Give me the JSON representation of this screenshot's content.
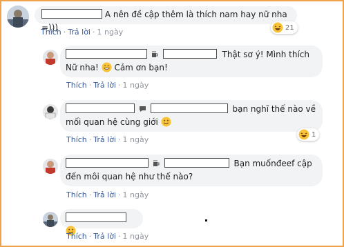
{
  "comments": [
    {
      "text": "A nên đề cập thêm là thích nam hay nữ nha =)))",
      "actions": {
        "like": "Thích",
        "reply": "Trả lời",
        "time": "1 ngày"
      },
      "reaction": {
        "emoji": "laughing",
        "count": "21"
      }
    },
    {
      "text_line1": "Thật sơ ý! Mình thích",
      "text_line2": "Nữ nha!",
      "text_line2_after": "Cảm ơn bạn!",
      "actions": {
        "like": "Thích",
        "reply": "Trả lời",
        "time": "1 ngày"
      }
    },
    {
      "text_line1": "bạn nghĩ thế nào về",
      "text_line2": "mối quan hệ cùng giới",
      "actions": {
        "like": "Thích",
        "reply": "Trả lời",
        "time": "1 ngày"
      },
      "reaction": {
        "emoji": "laughing",
        "count": "1"
      }
    },
    {
      "text_line1": "Bạn muốnđeef cập",
      "text_line2": "đến môi quan hệ như thế nào?",
      "actions": {
        "like": "Thích",
        "reply": "Trả lời",
        "time": "1 ngày"
      }
    },
    {
      "actions": {
        "like": "Thích",
        "reply": "Trả lời",
        "time": "1 ngày"
      }
    }
  ],
  "colors": {
    "link": "#385898",
    "bubble": "#f2f3f5",
    "frame": "#f0a24a"
  }
}
